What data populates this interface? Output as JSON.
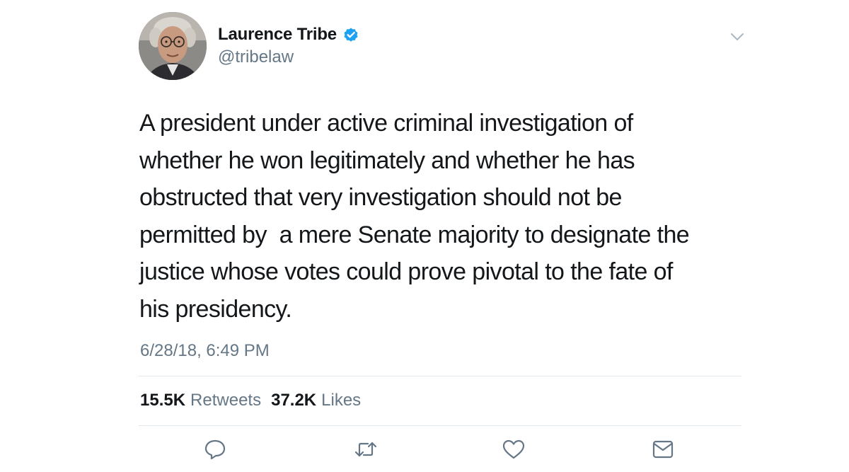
{
  "tweet": {
    "author": {
      "display_name": "Laurence Tribe",
      "handle": "@tribelaw",
      "verified": true,
      "avatar_icon": "profile-photo"
    },
    "text": "A president under active criminal investigation of\nwhether he won legitimately and whether he has\nobstructed that very investigation should not be\npermitted by  a mere Senate majority to designate the\njustice whose votes could prove pivotal to the fate of\nhis presidency.",
    "timestamp": "6/28/18, 6:49 PM",
    "stats": {
      "retweets_count": "15.5K",
      "retweets_label": "Retweets",
      "likes_count": "37.2K",
      "likes_label": "Likes"
    },
    "actions": [
      {
        "icon": "reply-icon"
      },
      {
        "icon": "retweet-icon"
      },
      {
        "icon": "heart-icon"
      },
      {
        "icon": "message-icon"
      }
    ]
  },
  "colors": {
    "text_primary": "#14171a",
    "text_secondary": "#657786",
    "verified_blue": "#1da1f2",
    "divider": "#e1e8ed",
    "icon_gray": "#657786"
  }
}
